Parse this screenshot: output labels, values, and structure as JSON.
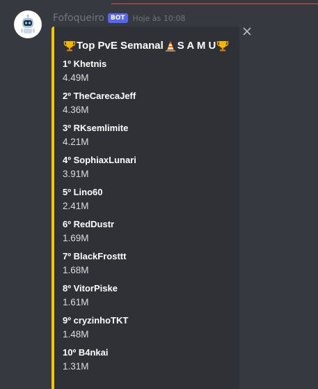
{
  "message": {
    "author": "Fofoqueiro",
    "bot_tag": "BOT",
    "timestamp": "Hoje às 10:08"
  },
  "embed": {
    "title_prefix": "Top PvE Semanal",
    "title_suffix": "S A M U",
    "accent_color": "#f1c40f",
    "icons": [
      "trophy-icon",
      "traffic-cone-icon",
      "trophy-icon"
    ],
    "entries": [
      {
        "rank": "1º Khetnis",
        "value": "4.49M"
      },
      {
        "rank": "2º TheCarecaJeff",
        "value": "4.36M"
      },
      {
        "rank": "3º RKsemlimite",
        "value": "4.21M"
      },
      {
        "rank": "4º SophiaxLunari",
        "value": "3.91M"
      },
      {
        "rank": "5º Lino60",
        "value": "2.41M"
      },
      {
        "rank": "6º RedDustr",
        "value": "1.69M"
      },
      {
        "rank": "7º BlackFrosttt",
        "value": "1.68M"
      },
      {
        "rank": "8º VitorPiske",
        "value": "1.61M"
      },
      {
        "rank": "9º cryzinhoTKT",
        "value": "1.48M"
      },
      {
        "rank": "10º B4nkai",
        "value": "1.31M"
      }
    ]
  },
  "controls": {
    "close_icon": "close-icon"
  }
}
